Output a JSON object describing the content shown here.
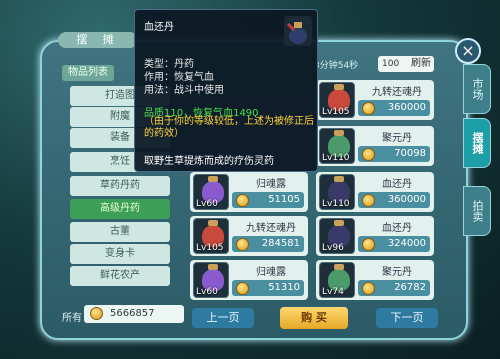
{
  "window": {
    "title": "摆 摊"
  },
  "side_tabs": [
    {
      "label": "市场",
      "active": false
    },
    {
      "label": "摆摊",
      "active": true
    },
    {
      "label": "拍卖",
      "active": false
    }
  ],
  "category_header": "物品列表",
  "categories": [
    {
      "label": "打造图",
      "active": false
    },
    {
      "label": "附魔",
      "active": false
    },
    {
      "label": "装备",
      "active": false
    },
    {
      "label": "烹饪",
      "active": false
    },
    {
      "label": "草药丹药",
      "active": false
    },
    {
      "label": "高级丹药",
      "active": true
    },
    {
      "label": "古董",
      "active": false
    },
    {
      "label": "变身卡",
      "active": false
    },
    {
      "label": "鲜花农产",
      "active": false
    }
  ],
  "wallet": {
    "label": "所有",
    "amount": "5666857"
  },
  "timer": "3分钟54秒",
  "refresh": {
    "count": "100",
    "label": "刷新"
  },
  "items": [
    {
      "name": "",
      "price": "",
      "level": "",
      "hidden": true
    },
    {
      "name": "九转还魂丹",
      "price": "360000",
      "level": "Lv105",
      "jar_color": "#c94a3a"
    },
    {
      "name": "",
      "price": "",
      "level": "",
      "hidden": true
    },
    {
      "name": "聚元丹",
      "price": "70098",
      "level": "Lv110",
      "jar_color": "#4a9a6a"
    },
    {
      "name": "归魂露",
      "price": "51105",
      "level": "Lv60",
      "jar_color": "#8a5acf"
    },
    {
      "name": "血还丹",
      "price": "360000",
      "level": "Lv110",
      "jar_color": "#3a3a6a"
    },
    {
      "name": "九转还魂丹",
      "price": "284581",
      "level": "Lv105",
      "jar_color": "#c94a3a"
    },
    {
      "name": "血还丹",
      "price": "324000",
      "level": "Lv96",
      "jar_color": "#3a3a6a"
    },
    {
      "name": "归魂露",
      "price": "51310",
      "level": "Lv60",
      "jar_color": "#8a5acf"
    },
    {
      "name": "聚元丹",
      "price": "26782",
      "level": "Lv74",
      "jar_color": "#4a9a6a"
    }
  ],
  "buttons": {
    "prev": "上一页",
    "buy": "购 买",
    "next": "下一页"
  },
  "tooltip": {
    "title": "血还丹",
    "type_line": "类型：丹药",
    "effect_line": "作用：恢复气血",
    "usage_line": "用法：战斗中使用",
    "quality": "品质110，恢复气血1490",
    "note": "（由于你的等级较低，上述为被修正后的药效）",
    "desc": "取野生草提炼而成的疗伤灵药"
  },
  "colors": {
    "accent": "#1e9ea6",
    "buy": "#ffd871",
    "tooltip_green": "#49e04a",
    "tooltip_yellow": "#ffd33c"
  }
}
